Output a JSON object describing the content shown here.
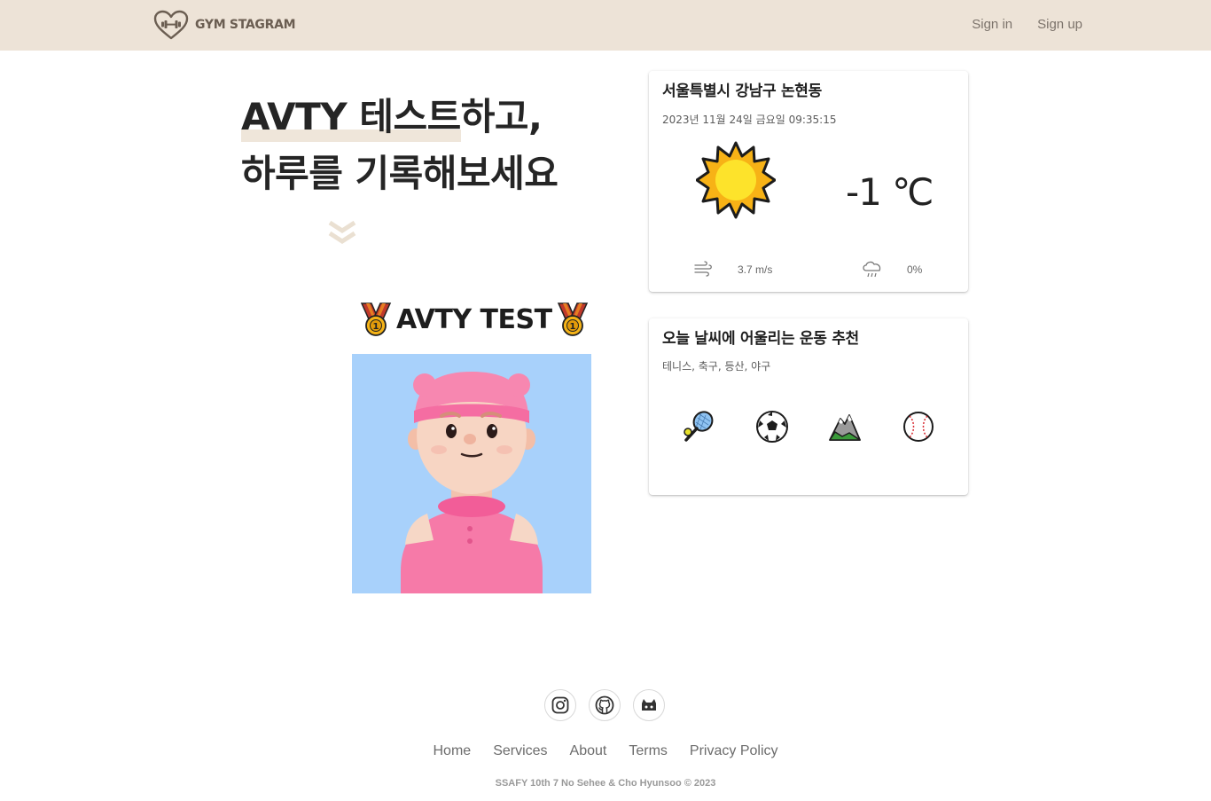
{
  "header": {
    "logo_text": "GYM STAGRAM",
    "logo_icon": "heart-dumbbell-icon",
    "nav": {
      "sign_in": "Sign in",
      "sign_up": "Sign up"
    },
    "bg_color": "#ede3d7"
  },
  "hero": {
    "line1_highlight": "AVTY 테스트",
    "line1_rest": "하고,",
    "line2": "하루를 기록해보세요",
    "scroll_icon": "double-chevron-down-icon"
  },
  "avty": {
    "title": "AVTY TEST",
    "medal_icon": "medal-icon",
    "avatar_icon": "avatar-illustration",
    "avatar_bg": "#a8d1fb"
  },
  "weather": {
    "location": "서울특별시 강남구 논현동",
    "datetime": "2023년 11월 24일 금요일 09:35:15",
    "condition_icon": "sun-icon",
    "temperature": "-1 ℃",
    "wind_icon": "wind-icon",
    "wind_speed": "3.7 m/s",
    "rain_icon": "rain-cloud-icon",
    "precipitation": "0%"
  },
  "recommend": {
    "title": "오늘 날씨에 어울리는 운동 추천",
    "sports": "테니스, 축구, 등산, 야구",
    "icons": [
      "tennis-racket-icon",
      "soccer-ball-icon",
      "mountain-icon",
      "baseball-icon"
    ]
  },
  "footer": {
    "social_icons": [
      "instagram-icon",
      "github-icon",
      "gitlab-icon"
    ],
    "links": {
      "home": "Home",
      "services": "Services",
      "about": "About",
      "terms": "Terms",
      "privacy": "Privacy Policy"
    },
    "copyright": "SSAFY 10th 7 No Sehee & Cho Hyunsoo © 2023"
  }
}
